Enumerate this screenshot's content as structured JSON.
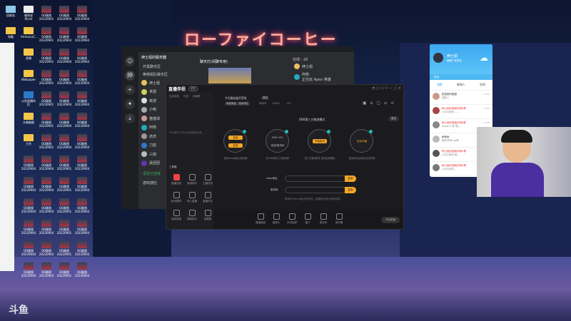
{
  "neon_sign": "ローファイコーヒー",
  "watermark": "斗鱼",
  "desktop_icons": [
    {
      "label": "回收站",
      "type": "bin"
    },
    {
      "label": "福利说明.txt",
      "type": "doc"
    },
    {
      "label": "QQ截图20220901",
      "type": "img"
    },
    {
      "label": "QQ截图20220904",
      "type": "img"
    },
    {
      "label": "QQ截图20220904",
      "type": "img"
    },
    {
      "label": "电脑",
      "type": "folder"
    },
    {
      "label": "ArmouryC...",
      "type": "folder"
    },
    {
      "label": "QQ截图20220901",
      "type": "img"
    },
    {
      "label": "QQ截图20220904",
      "type": "img"
    },
    {
      "label": "QQ截图20220904",
      "type": "img"
    },
    {
      "label": "",
      "type": "none"
    },
    {
      "label": "直播",
      "type": "folder"
    },
    {
      "label": "QQ截图20220901",
      "type": "img"
    },
    {
      "label": "QQ截图20220904",
      "type": "img"
    },
    {
      "label": "QQ截图20220904",
      "type": "img"
    },
    {
      "label": "",
      "type": "none"
    },
    {
      "label": "Wallpaper",
      "type": "folder"
    },
    {
      "label": "QQ截图20220901",
      "type": "img"
    },
    {
      "label": "QQ截图20220904",
      "type": "img"
    },
    {
      "label": "QQ截图20220904",
      "type": "img"
    },
    {
      "label": "",
      "type": "none"
    },
    {
      "label": "斗鱼直播伴侣",
      "type": "app"
    },
    {
      "label": "QQ截图20220901",
      "type": "img"
    },
    {
      "label": "QQ截图20220904",
      "type": "img"
    },
    {
      "label": "QQ截图20220904",
      "type": "img"
    },
    {
      "label": "",
      "type": "none"
    },
    {
      "label": "头像截图",
      "type": "folder"
    },
    {
      "label": "QQ截图20220901",
      "type": "img"
    },
    {
      "label": "QQ截图20220904",
      "type": "img"
    },
    {
      "label": "QQ截图20220904",
      "type": "img"
    },
    {
      "label": "",
      "type": "none"
    },
    {
      "label": "工作",
      "type": "folder"
    },
    {
      "label": "QQ截图20220901",
      "type": "img"
    },
    {
      "label": "QQ截图20220904",
      "type": "img"
    },
    {
      "label": "QQ截图20220904",
      "type": "img"
    }
  ],
  "discord": {
    "server_name": "绅士姐的服务器",
    "channels": [
      "开黑聊天区",
      "等候组队聊天区"
    ],
    "channel_header": "聊天灯(闲聊专用)",
    "online_header": "在线 - 20",
    "online": [
      {
        "name": "绅士姐"
      },
      {
        "name": "阿杨",
        "status": "正在玩 Apex 英雄"
      }
    ],
    "members": [
      "绅士姐",
      "世茵",
      "夜游",
      "小鸭",
      "猫猫球",
      "阿杨",
      "虎虎",
      "刀蓝",
      "三婉",
      "黑团团"
    ],
    "voice_status": "语音已连接",
    "user_area": "游戏感应"
  },
  "live": {
    "app_name": "直播伴侣",
    "badge": "钻石",
    "tabs": [
      "互动消息",
      "礼物",
      "贡献榜"
    ],
    "empty_msg": "OBS模式下无法查看弹幕消息",
    "room_title": "今天服务器开荒啦",
    "edit": "修改",
    "category": "网游竞技 · 绝地求生",
    "room_id": "房间号",
    "room_no": "72819",
    "viewers": "144",
    "obs_title": "OBS第三方推流模式",
    "exit": "退出",
    "steps": [
      {
        "btns": [
          "复制",
          "复制"
        ],
        "caption": "复制rtmp地址与推流码"
      },
      {
        "btns": [
          "RMS URL",
          "密钥/推流码"
        ],
        "caption": "在OBS填写上方推流码"
      },
      {
        "btns": [
          "开始推流"
        ],
        "caption": "第三方推流软件 推流后看播放"
      },
      {
        "btns": [
          "自动开播"
        ],
        "caption": "推流成功后系统 自动开播"
      }
    ],
    "rtmp_label": "rtmp地址",
    "key_label": "推流码",
    "copy": "复制",
    "hint": "推流码与rtmp地址有时效性，如果推流失败请重新复制",
    "toolbox": "工具箱",
    "tools": [
      "直播回放",
      "房管助手",
      "主播任务",
      "粉丝徽章",
      "导入直播",
      "直播评论",
      "选择频道",
      "弹幕助手",
      "观看数"
    ],
    "bottom": [
      "直播画面",
      "摄像头",
      "手机投屏",
      "窗口",
      "麦克风",
      "扬声器"
    ],
    "start_btn": "开始直播"
  },
  "qq": {
    "name": "绅士姐",
    "status": "编辑个性签名",
    "search": "搜索",
    "tabs": [
      "消息",
      "联系人",
      "空间"
    ],
    "chats": [
      {
        "name": "招招家的猫猫",
        "msg": "[图片]",
        "time": "13:56",
        "hl": false
      },
      {
        "name": "绅士姐的猫猫试驾A群",
        "msg": "(小众)你的:……",
        "time": "13:01",
        "hl": true
      },
      {
        "name": "绅士姐的猫猫试驾B群",
        "msg": "Dream:\"你\"笑…",
        "time": "17:40",
        "hl": true
      },
      {
        "name": "秋秋秋",
        "msg": "那你开好Luo呀",
        "time": "",
        "hl": false
      },
      {
        "name": "绅士姐的猫猫试驾C群",
        "msg": "(小众)你的:我…",
        "time": "",
        "hl": true
      },
      {
        "name": "绅士姐的猫猫试驾D群",
        "msg": "(小众)你的:…",
        "time": "",
        "hl": true
      }
    ]
  }
}
